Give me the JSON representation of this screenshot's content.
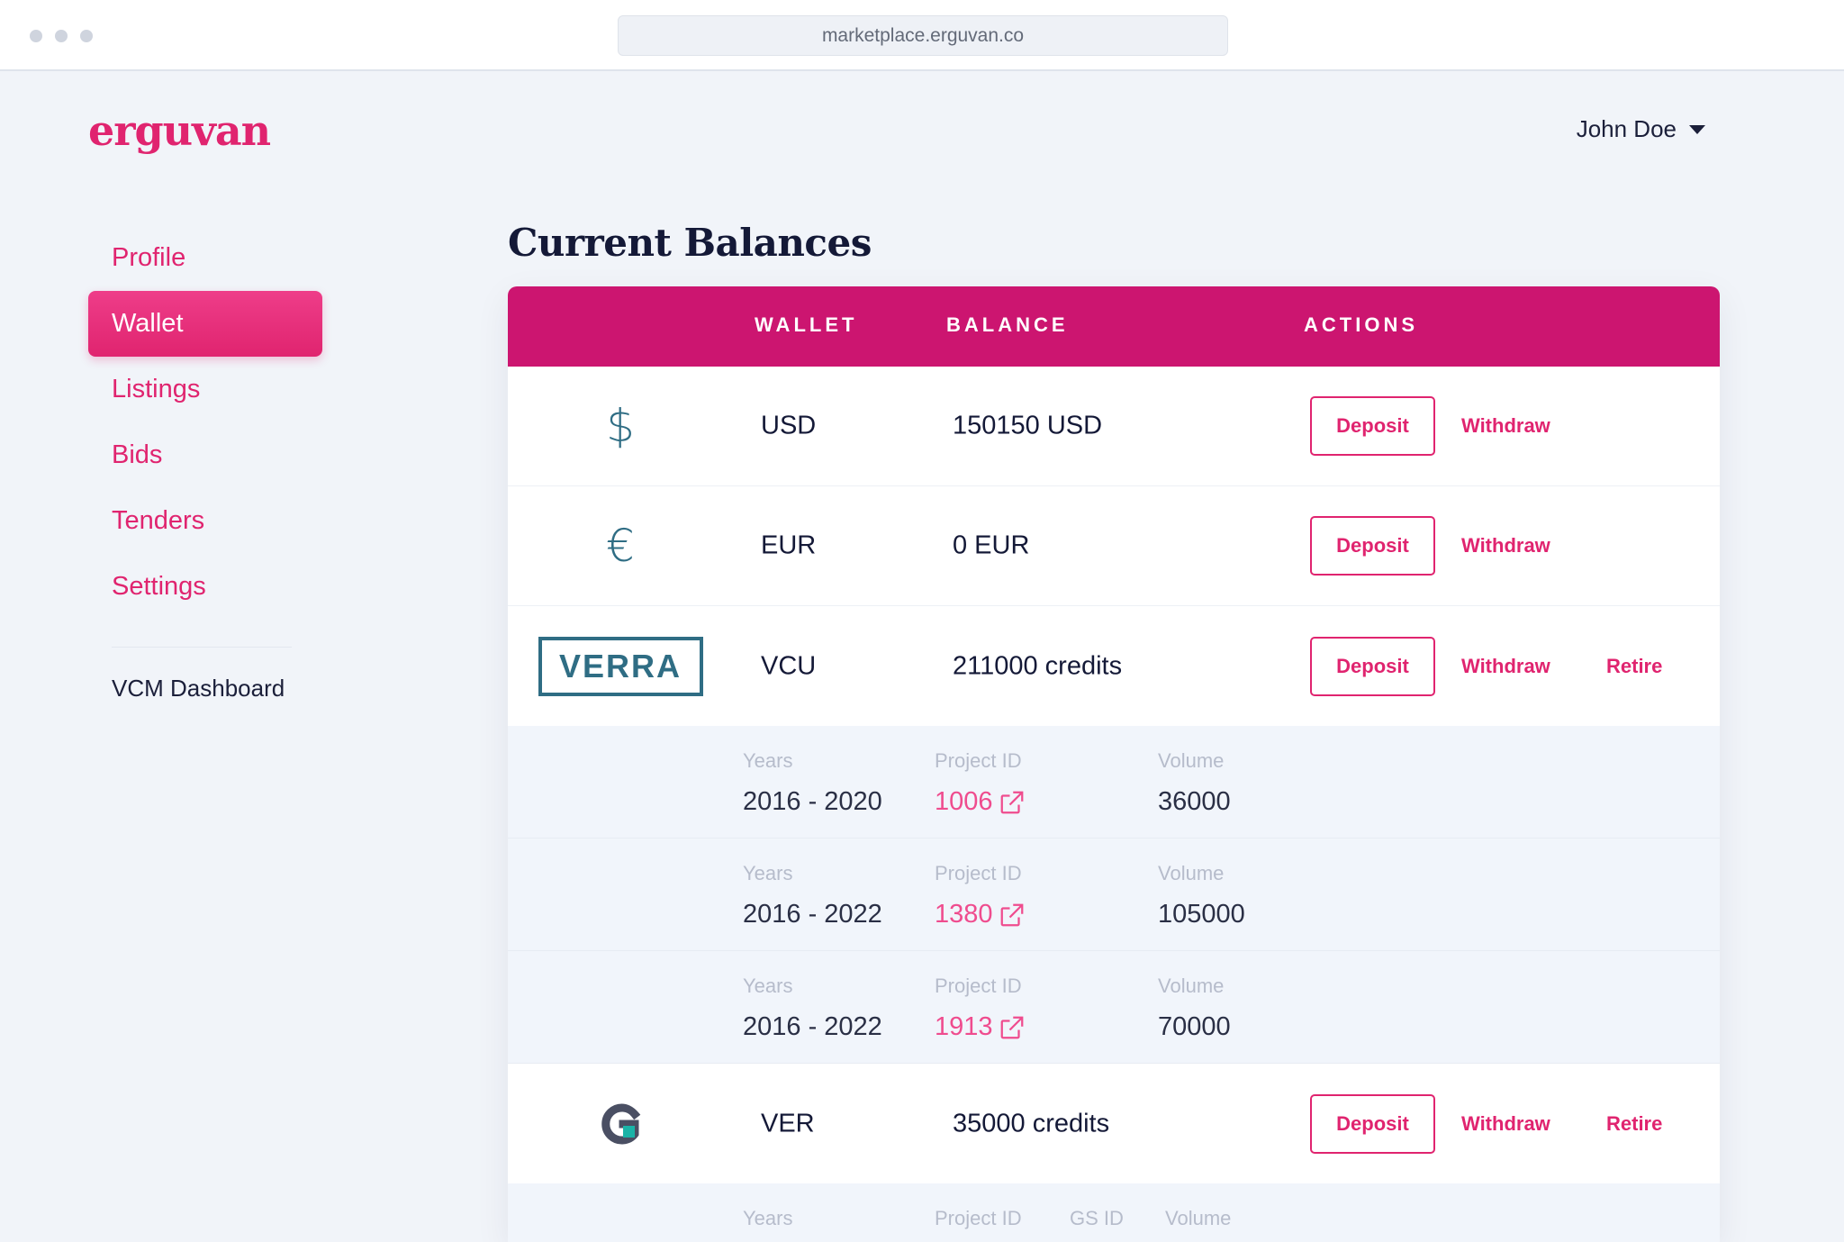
{
  "browser": {
    "url": "marketplace.erguvan.co"
  },
  "brand": {
    "logo_text": "erguvan",
    "color": "#e0246f"
  },
  "user": {
    "name": "John Doe"
  },
  "sidebar": {
    "items": [
      {
        "label": "Profile"
      },
      {
        "label": "Wallet",
        "active": true
      },
      {
        "label": "Listings"
      },
      {
        "label": "Bids"
      },
      {
        "label": "Tenders"
      },
      {
        "label": "Settings"
      }
    ],
    "secondary": "VCM Dashboard"
  },
  "page": {
    "title": "Current Balances"
  },
  "table": {
    "header_color": "#cc1570",
    "columns": {
      "wallet": "WALLET",
      "balance": "BALANCE",
      "actions": "ACTIONS"
    },
    "actions": {
      "deposit": "Deposit",
      "withdraw": "Withdraw",
      "retire": "Retire"
    },
    "rows": [
      {
        "icon": "dollar-icon",
        "glyph": "$",
        "wallet": "USD",
        "balance": "150150 USD"
      },
      {
        "icon": "euro-icon",
        "glyph": "€",
        "wallet": "EUR",
        "balance": "0 EUR"
      },
      {
        "icon": "verra-logo",
        "logo_text": "VERRA",
        "wallet": "VCU",
        "balance": "211000 credits"
      },
      {
        "icon": "gold-standard-logo",
        "wallet": "VER",
        "balance": "35000 credits"
      }
    ],
    "vcu_details": {
      "labels": {
        "years": "Years",
        "project_id": "Project ID",
        "volume": "Volume"
      },
      "items": [
        {
          "years": "2016 - 2020",
          "project_id": "1006",
          "volume": "36000"
        },
        {
          "years": "2016 - 2022",
          "project_id": "1380",
          "volume": "105000"
        },
        {
          "years": "2016 - 2022",
          "project_id": "1913",
          "volume": "70000"
        }
      ]
    },
    "ver_details": {
      "labels": {
        "years": "Years",
        "project_id": "Project ID",
        "gs_id": "GS ID",
        "volume": "Volume"
      }
    }
  }
}
